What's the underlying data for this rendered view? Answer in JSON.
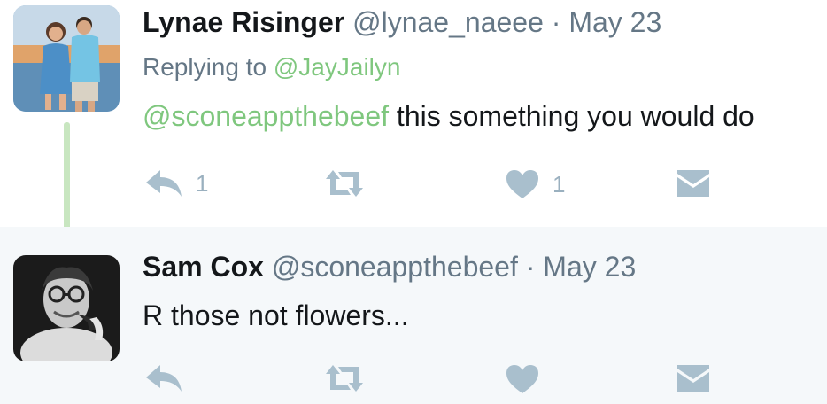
{
  "colors": {
    "accent_link": "#7fc77e",
    "icon_gray": "#a9bfcd",
    "secondary_text": "#657786",
    "thread_line": "#c8e6c0"
  },
  "tweets": [
    {
      "name": "Lynae Risinger",
      "handle": "@lynae_naeee",
      "separator": "·",
      "date": "May 23",
      "replying_prefix": "Replying to",
      "replying_handle": "@JayJailyn",
      "mention": "@sconeappthebeef",
      "text": "this something you would do",
      "reply_count": "1",
      "like_count": "1"
    },
    {
      "name": "Sam Cox",
      "handle": "@sconeappthebeef",
      "separator": "·",
      "date": "May 23",
      "text": "R those not flowers..."
    }
  ],
  "icons": {
    "reply": "reply-arrow-icon",
    "retweet": "retweet-icon",
    "like": "heart-icon",
    "message": "envelope-icon"
  }
}
